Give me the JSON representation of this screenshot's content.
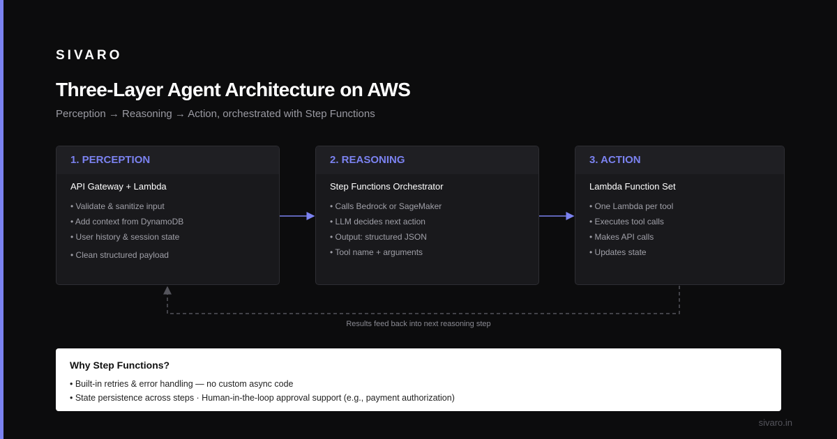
{
  "colors": {
    "accent": "#7b82f0",
    "background": "#0c0c0d",
    "card": "#19191c",
    "card_header": "#1f1f23",
    "dashed_line": "#55555c"
  },
  "brand": "SIVARO",
  "title": "Three-Layer Agent Architecture on AWS",
  "subtitle": "Perception → Reasoning → Action, orchestrated with Step Functions",
  "layers": [
    {
      "label": "1. PERCEPTION",
      "heading": "API Gateway + Lambda",
      "items": [
        "• Validate & sanitize input",
        "• Add context from DynamoDB",
        "• User history & session state",
        "• Clean structured payload"
      ]
    },
    {
      "label": "2. REASONING",
      "heading": "Step Functions Orchestrator",
      "items": [
        "• Calls Bedrock or SageMaker",
        "• LLM decides next action",
        "• Output: structured JSON",
        "• Tool name + arguments"
      ]
    },
    {
      "label": "3. ACTION",
      "heading": "Lambda Function Set",
      "items": [
        "• One Lambda per tool",
        "• Executes tool calls",
        "• Makes API calls",
        "• Updates state"
      ]
    }
  ],
  "feedback_caption": "Results feed back into next reasoning step",
  "why": {
    "title": "Why Step Functions?",
    "items": [
      "• Built-in retries & error handling — no custom async code",
      "• State persistence across steps · Human-in-the-loop approval support (e.g., payment authorization)"
    ]
  },
  "footer": "sivaro.in"
}
